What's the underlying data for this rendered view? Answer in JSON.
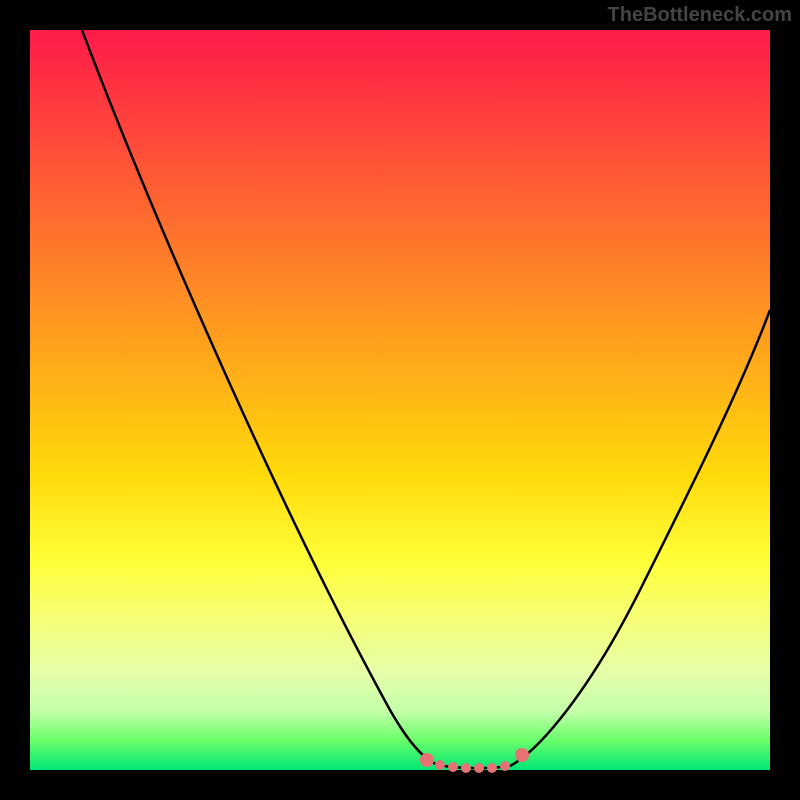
{
  "watermark": "TheBottleneck.com",
  "colors": {
    "gradient_top": "#ff1a4a",
    "gradient_bottom": "#00e676",
    "curve": "#000000",
    "dot": "#e57373",
    "frame": "#000000"
  },
  "chart_data": {
    "type": "line",
    "title": "",
    "xlabel": "",
    "ylabel": "",
    "xlim": [
      0,
      100
    ],
    "ylim": [
      0,
      100
    ],
    "series": [
      {
        "name": "left-curve",
        "x": [
          7,
          12,
          18,
          24,
          30,
          36,
          42,
          48,
          52,
          55
        ],
        "y": [
          100,
          86,
          72,
          58,
          44,
          30,
          18,
          8,
          3,
          1
        ]
      },
      {
        "name": "right-curve",
        "x": [
          64,
          68,
          74,
          80,
          86,
          92,
          98,
          100
        ],
        "y": [
          1,
          3,
          10,
          20,
          33,
          46,
          58,
          62
        ]
      },
      {
        "name": "bottleneck-points",
        "x": [
          53,
          55,
          57,
          59,
          61,
          63,
          65,
          67
        ],
        "y": [
          2,
          1,
          0.5,
          0.5,
          0.5,
          0.5,
          1,
          3
        ]
      }
    ],
    "annotations": []
  }
}
